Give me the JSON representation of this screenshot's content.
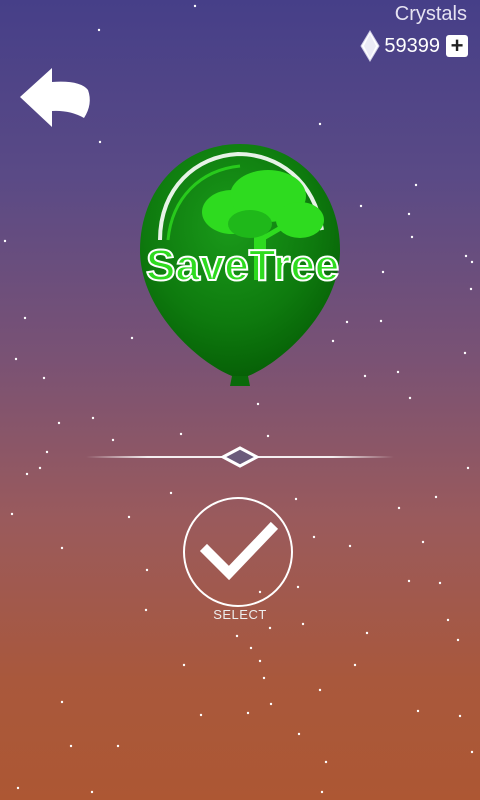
{
  "header": {
    "currency_label": "Crystals",
    "currency_amount": "59399",
    "plus_label": "+",
    "crystal_icon": "diamond-icon",
    "back_icon": "back-arrow-icon"
  },
  "balloon": {
    "skin_text": "SaveTree",
    "color": "#0f7a0f",
    "accent": "#2edb1f"
  },
  "selector": {
    "select_label": "SELECT",
    "select_icon": "checkmark-icon"
  }
}
